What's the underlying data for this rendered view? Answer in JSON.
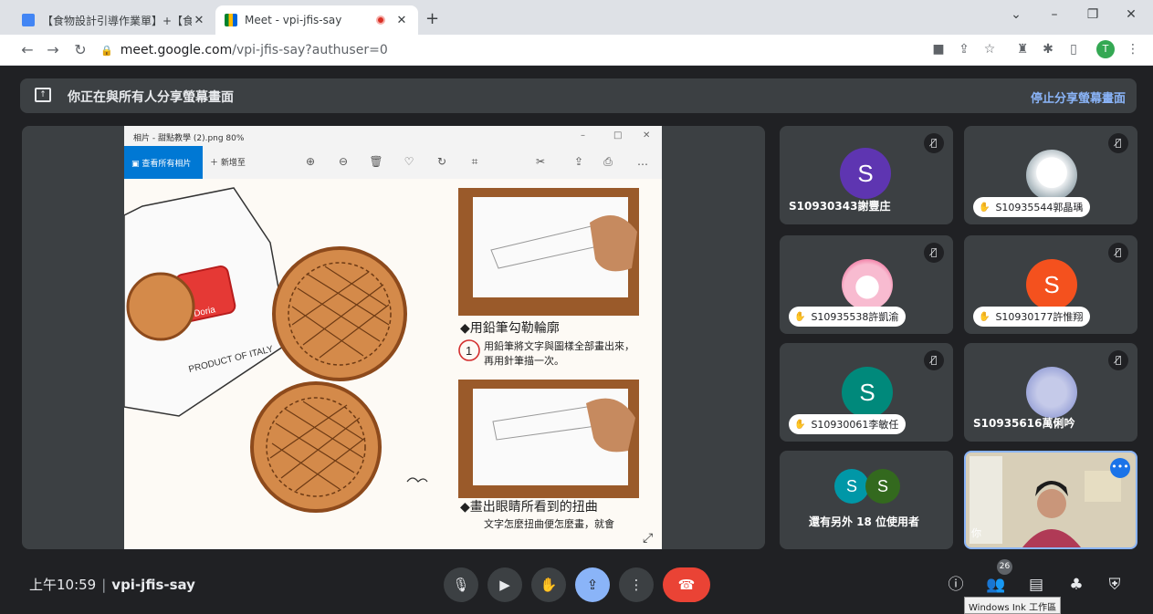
{
  "browser": {
    "tabs": [
      {
        "title": "【食物設計引導作業單】+【食",
        "active": false
      },
      {
        "title": "Meet - vpi-jfis-say",
        "active": true
      }
    ],
    "close_glyph": "✕",
    "new_tab_glyph": "+",
    "url_host": "meet.google.com",
    "url_path": "/vpi-jfis-say?authuser=0",
    "profile_initial": "T",
    "window_controls": [
      "⌄",
      "–",
      "❐",
      "✕"
    ]
  },
  "meet": {
    "share_banner": {
      "message": "你正在與所有人分享螢幕畫面",
      "stop_label": "停止分享螢幕畫面"
    },
    "viewer": {
      "title": "相片 - 甜點教學 (2).png  80%",
      "all_photos_label": "查看所有相片",
      "add_to_label": "新增至",
      "text_step1_heading": "◆用鉛筆勾勒輪廓",
      "text_step1_body": "用鉛筆將文字與圖樣全部畫出來，再用針筆描一次。",
      "text_step2_heading": "◆畫出眼睛所看到的扭曲",
      "text_step2_body": "文字怎麼扭曲便怎麼畫，就會",
      "step_number": "1",
      "package_text": "PRODUCT OF ITALY",
      "brand_text": "Doria"
    },
    "participants": [
      {
        "name": "S10930343謝豐庄",
        "initial": "S",
        "color": "#5e35b1",
        "style": "plain"
      },
      {
        "name": "S10935544郭晶瑀",
        "initial": "",
        "color": "#cfd8dc",
        "style": "pill"
      },
      {
        "name": "S10935538許凱渝",
        "initial": "",
        "color": "#f8bbd0",
        "style": "pill"
      },
      {
        "name": "S10930177許惟翔",
        "initial": "S",
        "color": "#f4511e",
        "style": "pill"
      },
      {
        "name": "S10930061李敏任",
        "initial": "S",
        "color": "#00897b",
        "style": "pill"
      },
      {
        "name": "S10935616萬俐吟",
        "initial": "",
        "color": "#9fa8da",
        "style": "plain"
      }
    ],
    "others_label": "還有另外 18 位使用者",
    "others_avatars": [
      {
        "initial": "S",
        "color": "#0097a7"
      },
      {
        "initial": "S",
        "color": "#33691e"
      }
    ],
    "self_label": "你",
    "bottom_bar": {
      "time": "上午10:59",
      "meeting_code": "vpi-jfis-say",
      "people_count": "26",
      "tooltip": "Windows Ink 工作區"
    }
  }
}
